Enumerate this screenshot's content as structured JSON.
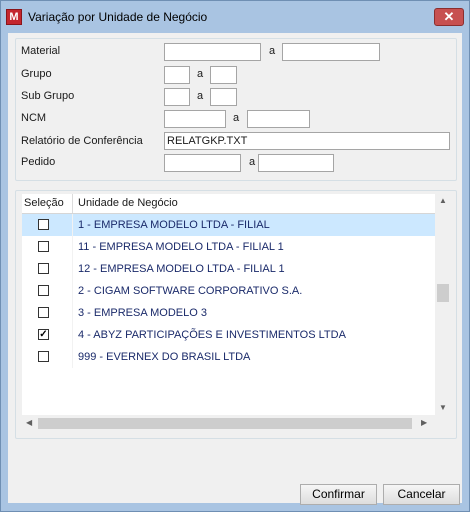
{
  "window": {
    "title": "Variação por Unidade de Negócio",
    "app_icon": "M",
    "close_label": "✕"
  },
  "form": {
    "material": {
      "label": "Material",
      "from": "",
      "sep": "a",
      "to": ""
    },
    "grupo": {
      "label": "Grupo",
      "from": "",
      "sep": "a",
      "to": ""
    },
    "subgrupo": {
      "label": "Sub Grupo",
      "from": "",
      "sep": "a",
      "to": ""
    },
    "ncm": {
      "label": "NCM",
      "from": "",
      "sep": "a",
      "to": ""
    },
    "relatorio": {
      "label": "Relatório de Conferência",
      "value": "RELATGKP.TXT"
    },
    "pedido": {
      "label": "Pedido",
      "from": "",
      "sep": "a",
      "to": ""
    }
  },
  "grid": {
    "col_selecao": "Seleção",
    "col_unidade": "Unidade de Negócio",
    "rows": [
      {
        "label": "1 - EMPRESA MODELO LTDA - FILIAL",
        "checked": false,
        "selected": true
      },
      {
        "label": "11 - EMPRESA MODELO LTDA - FILIAL 1",
        "checked": false,
        "selected": false
      },
      {
        "label": "12 - EMPRESA MODELO LTDA - FILIAL 1",
        "checked": false,
        "selected": false
      },
      {
        "label": "2 - CIGAM SOFTWARE CORPORATIVO S.A.",
        "checked": false,
        "selected": false
      },
      {
        "label": "3 - EMPRESA MODELO 3",
        "checked": false,
        "selected": false
      },
      {
        "label": "4 - ABYZ PARTICIPAÇÕES E INVESTIMENTOS LTDA",
        "checked": true,
        "selected": false
      },
      {
        "label": "999 - EVERNEX DO BRASIL LTDA",
        "checked": false,
        "selected": false
      }
    ]
  },
  "buttons": {
    "confirmar": "Confirmar",
    "cancelar": "Cancelar"
  }
}
